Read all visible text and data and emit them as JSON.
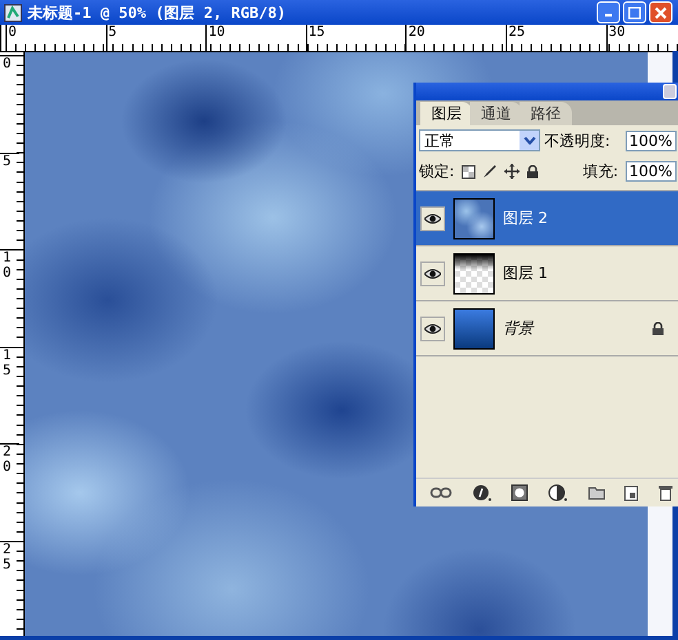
{
  "window": {
    "title": "未标题-1 @ 50% (图层 2, RGB/8)"
  },
  "ruler_top": {
    "labels": [
      "0",
      "5",
      "10",
      "15",
      "20",
      "25",
      "30"
    ]
  },
  "ruler_left": {
    "labels": [
      "0",
      "5",
      "10",
      "15",
      "20",
      "25"
    ]
  },
  "layers_panel": {
    "tabs": [
      {
        "label": "图层",
        "selected": true
      },
      {
        "label": "通道",
        "selected": false
      },
      {
        "label": "路径",
        "selected": false
      }
    ],
    "blend_mode": "正常",
    "opacity_label": "不透明度:",
    "opacity": "100%",
    "lock_label": "锁定:",
    "fill_label": "填充:",
    "fill": "100%",
    "layers": [
      {
        "name": "图层 2",
        "kind": "clouds",
        "selected": true,
        "locked": false
      },
      {
        "name": "图层 1",
        "kind": "fade",
        "selected": false,
        "locked": false
      },
      {
        "name": "背景",
        "kind": "background",
        "selected": false,
        "locked": true
      }
    ]
  }
}
